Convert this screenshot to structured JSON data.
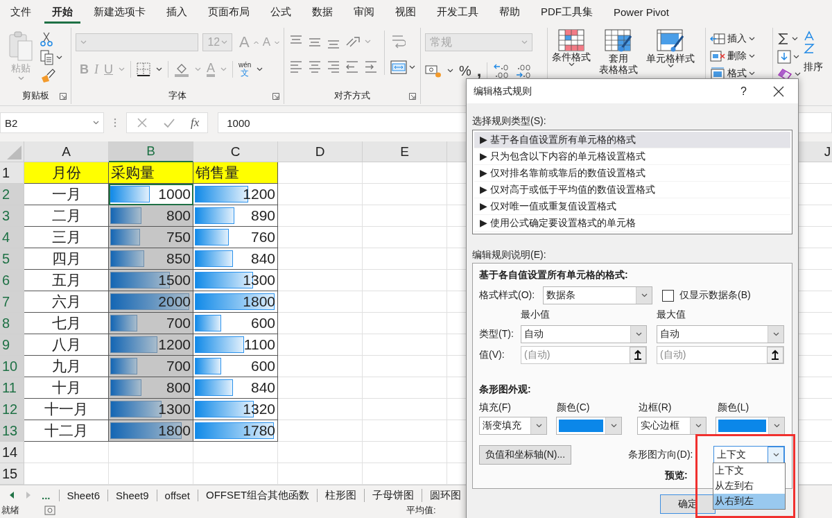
{
  "menu_tabs": [
    {
      "label": "文件",
      "selected": false
    },
    {
      "label": "开始",
      "selected": true
    },
    {
      "label": "新建选项卡",
      "selected": false
    },
    {
      "label": "插入",
      "selected": false
    },
    {
      "label": "页面布局",
      "selected": false
    },
    {
      "label": "公式",
      "selected": false
    },
    {
      "label": "数据",
      "selected": false
    },
    {
      "label": "审阅",
      "selected": false
    },
    {
      "label": "视图",
      "selected": false
    },
    {
      "label": "开发工具",
      "selected": false
    },
    {
      "label": "帮助",
      "selected": false
    },
    {
      "label": "PDF工具集",
      "selected": false
    },
    {
      "label": "Power Pivot",
      "selected": false
    }
  ],
  "ribbon": {
    "clipboard": {
      "paste": "粘贴",
      "paste_disabled": true,
      "title": "剪贴板"
    },
    "font": {
      "disabled": true,
      "size": "12",
      "grow": "A",
      "shrink": "A",
      "bold": "B",
      "italic": "I",
      "underline": "U",
      "text_color_label": "A",
      "phonetic": "wén",
      "phonetic_char": "文",
      "title": "字体"
    },
    "alignment": {
      "title": "对齐方式"
    },
    "number": {
      "disabled": true,
      "format": "常规",
      "percent": "%",
      "comma": ","
    },
    "styles": {
      "conditional": "条件格式",
      "table_top": "套用",
      "table_bottom": "表格格式",
      "cell_styles": "单元格样式"
    },
    "cells": {
      "insert": "插入",
      "delete": "删除",
      "format": "格式"
    },
    "editing": {
      "sort": "排序"
    }
  },
  "formula_bar": {
    "name_box": "B2",
    "fx": "fx",
    "value": "1000"
  },
  "sheet": {
    "columns": [
      {
        "label": "A",
        "selected": false,
        "after_gap": false
      },
      {
        "label": "B",
        "selected": true,
        "after_gap": false
      },
      {
        "label": "C",
        "selected": false,
        "after_gap": false
      },
      {
        "label": "D",
        "selected": false,
        "after_gap": false
      },
      {
        "label": "E",
        "selected": false,
        "after_gap": false
      },
      {
        "label": "J",
        "selected": false,
        "after_gap": true
      }
    ],
    "rows": [
      {
        "header": "1",
        "selected": false,
        "cells": [
          {
            "kind": "heading",
            "text": "月份",
            "centered": true
          },
          {
            "kind": "heading",
            "text": "采购量",
            "centered": false
          },
          {
            "kind": "heading",
            "text": "销售量",
            "centered": false
          }
        ]
      },
      {
        "header": "2",
        "selected": true,
        "cells": [
          {
            "kind": "text",
            "text": "一月"
          },
          {
            "kind": "bar",
            "text": "1000",
            "level": 0.49,
            "selected": false,
            "active": true
          },
          {
            "kind": "bar",
            "text": "1200",
            "level": 0.66,
            "selected": false,
            "active": false
          }
        ]
      },
      {
        "header": "3",
        "selected": true,
        "cells": [
          {
            "kind": "text",
            "text": "二月"
          },
          {
            "kind": "bar",
            "text": "800",
            "level": 0.39,
            "selected": true,
            "active": false
          },
          {
            "kind": "bar",
            "text": "890",
            "level": 0.49,
            "selected": false,
            "active": false
          }
        ]
      },
      {
        "header": "4",
        "selected": true,
        "cells": [
          {
            "kind": "text",
            "text": "三月"
          },
          {
            "kind": "bar",
            "text": "750",
            "level": 0.37,
            "selected": true,
            "active": false
          },
          {
            "kind": "bar",
            "text": "760",
            "level": 0.42,
            "selected": false,
            "active": false
          }
        ]
      },
      {
        "header": "5",
        "selected": true,
        "cells": [
          {
            "kind": "text",
            "text": "四月"
          },
          {
            "kind": "bar",
            "text": "850",
            "level": 0.42,
            "selected": true,
            "active": false
          },
          {
            "kind": "bar",
            "text": "840",
            "level": 0.47,
            "selected": false,
            "active": false
          }
        ]
      },
      {
        "header": "6",
        "selected": true,
        "cells": [
          {
            "kind": "text",
            "text": "五月"
          },
          {
            "kind": "bar",
            "text": "1500",
            "level": 0.74,
            "selected": true,
            "active": false
          },
          {
            "kind": "bar",
            "text": "1300",
            "level": 0.72,
            "selected": false,
            "active": false
          }
        ]
      },
      {
        "header": "7",
        "selected": true,
        "cells": [
          {
            "kind": "text",
            "text": "六月"
          },
          {
            "kind": "bar",
            "text": "2000",
            "level": 0.98,
            "selected": true,
            "active": false
          },
          {
            "kind": "bar",
            "text": "1800",
            "level": 0.99,
            "selected": false,
            "active": false
          }
        ]
      },
      {
        "header": "8",
        "selected": true,
        "cells": [
          {
            "kind": "text",
            "text": "七月"
          },
          {
            "kind": "bar",
            "text": "700",
            "level": 0.34,
            "selected": true,
            "active": false
          },
          {
            "kind": "bar",
            "text": "600",
            "level": 0.33,
            "selected": false,
            "active": false
          }
        ]
      },
      {
        "header": "9",
        "selected": true,
        "cells": [
          {
            "kind": "text",
            "text": "八月"
          },
          {
            "kind": "bar",
            "text": "1200",
            "level": 0.59,
            "selected": true,
            "active": false
          },
          {
            "kind": "bar",
            "text": "1100",
            "level": 0.61,
            "selected": false,
            "active": false
          }
        ]
      },
      {
        "header": "10",
        "selected": true,
        "cells": [
          {
            "kind": "text",
            "text": "九月"
          },
          {
            "kind": "bar",
            "text": "700",
            "level": 0.34,
            "selected": true,
            "active": false
          },
          {
            "kind": "bar",
            "text": "600",
            "level": 0.33,
            "selected": false,
            "active": false
          }
        ]
      },
      {
        "header": "11",
        "selected": true,
        "cells": [
          {
            "kind": "text",
            "text": "十月"
          },
          {
            "kind": "bar",
            "text": "800",
            "level": 0.39,
            "selected": true,
            "active": false
          },
          {
            "kind": "bar",
            "text": "840",
            "level": 0.47,
            "selected": false,
            "active": false
          }
        ]
      },
      {
        "header": "12",
        "selected": true,
        "cells": [
          {
            "kind": "text",
            "text": "十一月"
          },
          {
            "kind": "bar",
            "text": "1300",
            "level": 0.64,
            "selected": true,
            "active": false
          },
          {
            "kind": "bar",
            "text": "1320",
            "level": 0.73,
            "selected": false,
            "active": false
          }
        ]
      },
      {
        "header": "13",
        "selected": true,
        "cells": [
          {
            "kind": "text",
            "text": "十二月"
          },
          {
            "kind": "bar",
            "text": "1800",
            "level": 0.89,
            "selected": true,
            "active": false
          },
          {
            "kind": "bar",
            "text": "1780",
            "level": 0.98,
            "selected": false,
            "active": false
          }
        ]
      },
      {
        "header": "14",
        "selected": false,
        "cells": []
      },
      {
        "header": "15",
        "selected": false,
        "cells": []
      }
    ]
  },
  "sheet_tabs": {
    "more": "...",
    "tabs": [
      {
        "label": "Sheet6",
        "selected": false
      },
      {
        "label": "Sheet9",
        "selected": false
      },
      {
        "label": "offset",
        "selected": false
      },
      {
        "label": "OFFSET组合其他函数",
        "selected": false
      },
      {
        "label": "柱形图",
        "selected": false
      },
      {
        "label": "子母饼图",
        "selected": false
      },
      {
        "label": "圆环图",
        "selected": false
      }
    ]
  },
  "status_bar": {
    "ready": "就绪",
    "average": "平均值:"
  },
  "dialog": {
    "title": "编辑格式规则",
    "help": "?",
    "rule_type_label": "选择规则类型(S):",
    "rule_types": [
      {
        "label": "▶ 基于各自值设置所有单元格的格式",
        "selected": true
      },
      {
        "label": "▶ 只为包含以下内容的单元格设置格式",
        "selected": false
      },
      {
        "label": "▶ 仅对排名靠前或靠后的数值设置格式",
        "selected": false
      },
      {
        "label": "▶ 仅对高于或低于平均值的数值设置格式",
        "selected": false
      },
      {
        "label": "▶ 仅对唯一值或重复值设置格式",
        "selected": false
      },
      {
        "label": "▶ 使用公式确定要设置格式的单元格",
        "selected": false
      }
    ],
    "description_label": "编辑规则说明(E):",
    "description_title": "基于各自值设置所有单元格的格式:",
    "format_style": {
      "label": "格式样式(O):",
      "value": "数据条"
    },
    "bar_only": {
      "label": "仅显示数据条(B)",
      "checked": false
    },
    "type_label": "类型(T):",
    "value_label": "值(V):",
    "minimum": {
      "heading": "最小值",
      "type": "自动",
      "value": "(自动)",
      "value_disabled": true
    },
    "maximum": {
      "heading": "最大值",
      "type": "自动",
      "value": "(自动)",
      "value_disabled": true
    },
    "appearance_title": "条形图外观:",
    "fill": {
      "label": "填充(F)",
      "value": "渐变填充"
    },
    "fill_color": {
      "label": "颜色(C)",
      "color": "#0b87e9"
    },
    "border": {
      "label": "边框(R)",
      "value": "实心边框"
    },
    "border_color": {
      "label": "颜色(L)",
      "color": "#0b87e9"
    },
    "negative_button": "负值和坐标轴(N)...",
    "direction": {
      "label": "条形图方向(D):",
      "value": "上下文",
      "expanded": true,
      "options": [
        {
          "label": "上下文",
          "highlighted": false
        },
        {
          "label": "从左到右",
          "highlighted": false
        },
        {
          "label": "从右到左",
          "highlighted": true
        }
      ]
    },
    "preview_label": "预览:",
    "ok_button": "确定"
  },
  "annotation": {
    "kind": "frame"
  }
}
